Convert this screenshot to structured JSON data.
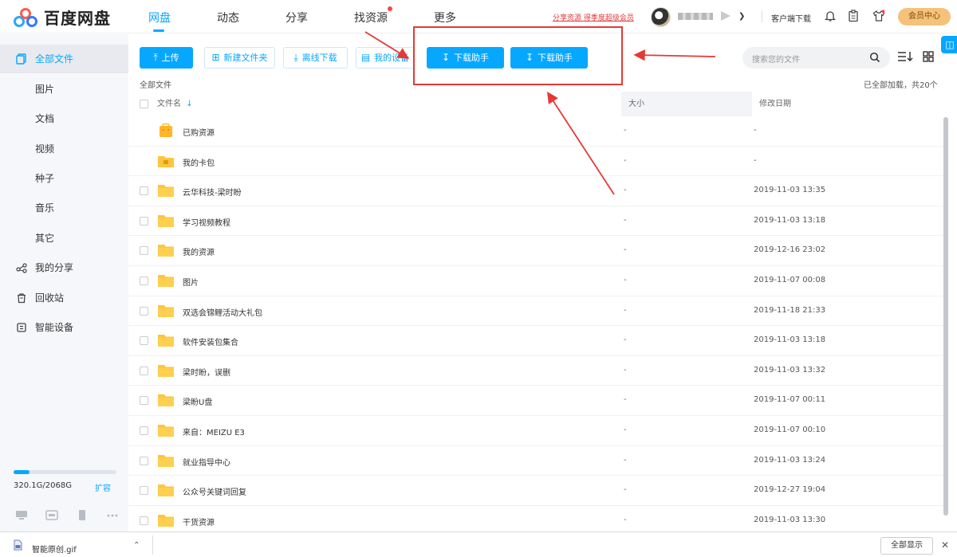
{
  "app": {
    "name": "百度网盘"
  },
  "nav": {
    "tabs": [
      "网盘",
      "动态",
      "分享",
      "找资源",
      "更多"
    ],
    "active": "网盘",
    "promo_link": "分享资源 得季度超级会员",
    "client_download": "客户端下载",
    "vip_center": "会员中心"
  },
  "sidebar": {
    "items": [
      {
        "label": "全部文件",
        "icon": "all-files-icon"
      },
      {
        "label": "图片"
      },
      {
        "label": "文档"
      },
      {
        "label": "视频"
      },
      {
        "label": "种子"
      },
      {
        "label": "音乐"
      },
      {
        "label": "其它"
      },
      {
        "label": "我的分享",
        "icon": "share-icon"
      },
      {
        "label": "回收站",
        "icon": "trash-icon"
      },
      {
        "label": "智能设备",
        "icon": "device-icon"
      }
    ],
    "quota_text": "320.1G/2068G",
    "quota_fraction": 0.155,
    "expand_label": "扩容"
  },
  "toolbar": {
    "upload": "上传",
    "new_folder": "新建文件夹",
    "offline_download": "离线下载",
    "my_devices": "我的设备",
    "download_helper_1": "下载助手",
    "download_helper_2": "下载助手",
    "search_placeholder": "搜索您的文件"
  },
  "breadcrumb": "全部文件",
  "load_info": "已全部加载，共20个",
  "table": {
    "headers": {
      "name": "文件名",
      "size": "大小",
      "date": "修改日期"
    },
    "rows": [
      {
        "name": "已购资源",
        "size": "-",
        "date": "-",
        "special": "purchased",
        "checkbox": false
      },
      {
        "name": "我的卡包",
        "size": "-",
        "date": "-",
        "special": "cardbag",
        "checkbox": false
      },
      {
        "name": "云华科技-梁时盼",
        "size": "-",
        "date": "2019-11-03 13:35",
        "checkbox": true
      },
      {
        "name": "学习视频教程",
        "size": "-",
        "date": "2019-11-03 13:18",
        "checkbox": true
      },
      {
        "name": "我的资源",
        "size": "-",
        "date": "2019-12-16 23:02",
        "checkbox": true
      },
      {
        "name": "图片",
        "size": "-",
        "date": "2019-11-07 00:08",
        "checkbox": true
      },
      {
        "name": "双选会锦鲤活动大礼包",
        "size": "-",
        "date": "2019-11-18 21:33",
        "checkbox": true
      },
      {
        "name": "软件安装包集合",
        "size": "-",
        "date": "2019-11-03 13:18",
        "checkbox": true
      },
      {
        "name": "梁时盼，误删",
        "size": "-",
        "date": "2019-11-03 13:32",
        "checkbox": true
      },
      {
        "name": "梁盼U盘",
        "size": "-",
        "date": "2019-11-07 00:11",
        "checkbox": true
      },
      {
        "name": "来自：MEIZU E3",
        "size": "-",
        "date": "2019-11-07 00:10",
        "checkbox": true
      },
      {
        "name": "就业指导中心",
        "size": "-",
        "date": "2019-11-03 13:24",
        "checkbox": true
      },
      {
        "name": "公众号关键词回复",
        "size": "-",
        "date": "2019-12-27 19:04",
        "checkbox": true
      },
      {
        "name": "干货资源",
        "size": "-",
        "date": "2019-11-03 13:30",
        "checkbox": true
      }
    ]
  },
  "download_bar": {
    "file": "智能原创.gif",
    "show_all": "全部显示"
  },
  "colors": {
    "accent": "#06a7ff",
    "annotation": "#e53935",
    "folder": "#ffc53d",
    "vip": "#f5c27a"
  }
}
